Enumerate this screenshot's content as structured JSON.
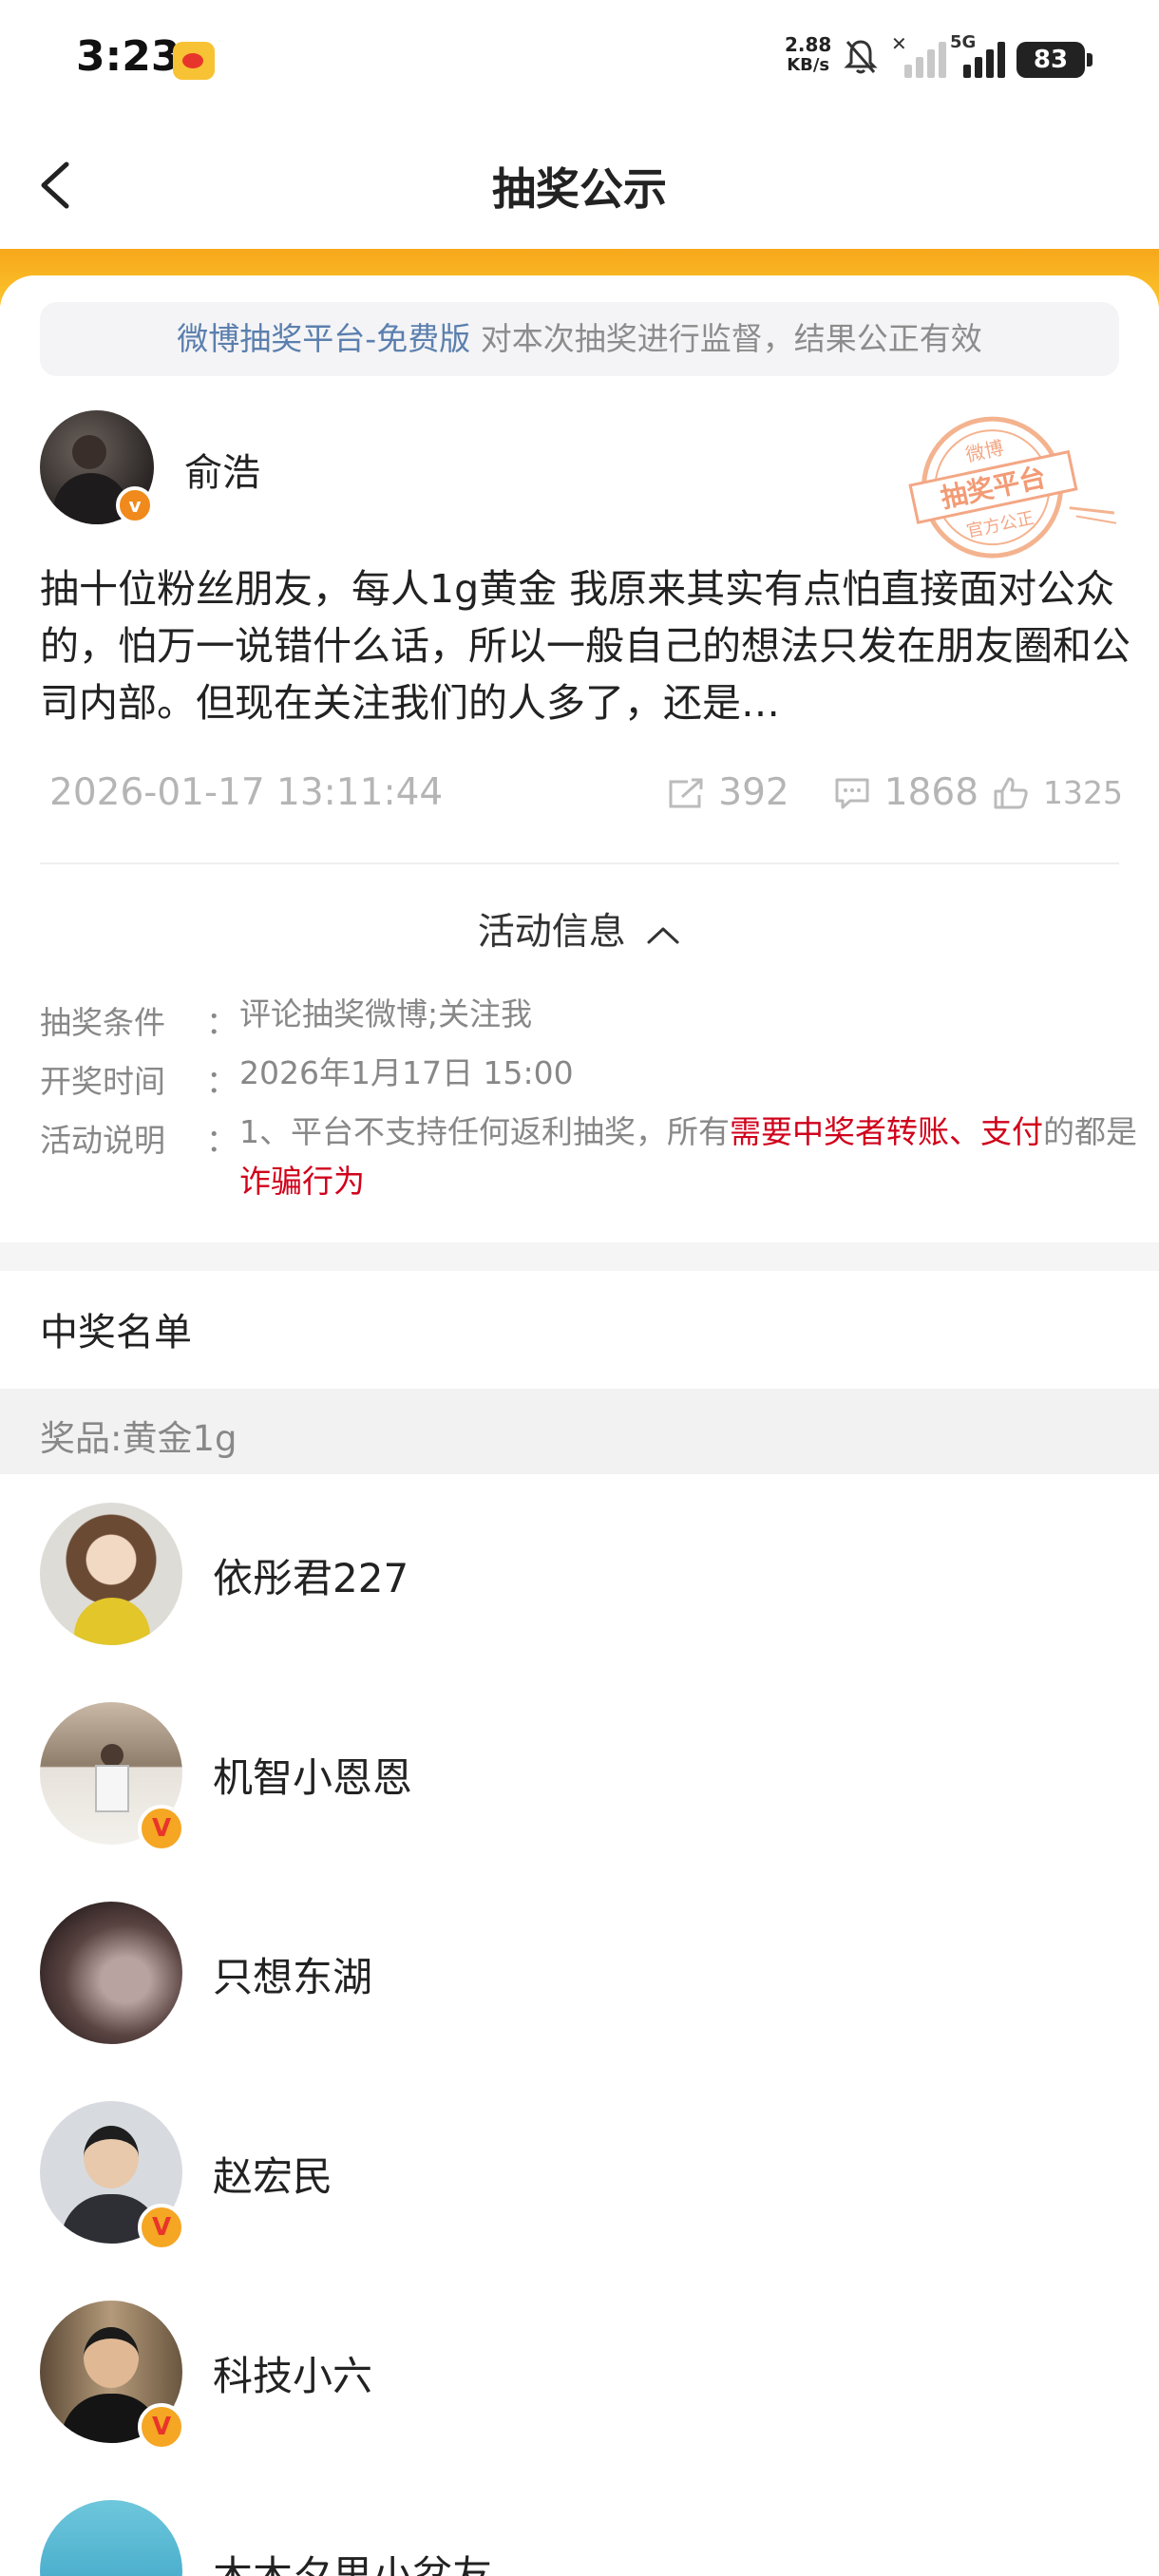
{
  "status_bar": {
    "time": "3:23",
    "net_speed_value": "2.88",
    "net_speed_unit": "KB/s",
    "network": "5G",
    "battery": "83"
  },
  "header": {
    "title": "抽奖公示"
  },
  "notice": {
    "link_text": "微博抽奖平台-免费版",
    "text": " 对本次抽奖进行监督，结果公正有效"
  },
  "post": {
    "author": "俞浩",
    "text": "抽十位粉丝朋友，每人1g黄金 我原来其实有点怕直接面对公众的，怕万一说错什么话，所以一般自己的想法只发在朋友圈和公司内部。但现在关注我们的人多了，还是…",
    "date": "2026-01-17 13:11:44",
    "reposts": "392",
    "comments": "1868",
    "likes": "1325",
    "stamp_top": "微博",
    "stamp_main": "抽奖平台",
    "stamp_bottom": "官方公正"
  },
  "activity": {
    "toggle_label": "活动信息",
    "condition_label": "抽奖条件",
    "condition_value": "评论抽奖微博;关注我",
    "time_label": "开奖时间",
    "time_value": "2026年1月17日 15:00",
    "desc_label": "活动说明",
    "desc_part1": "1、平台不支持任何返利抽奖，所有",
    "desc_red1": "需要中奖者转账、支付",
    "desc_part2": "的都是",
    "desc_red2": "诈骗行为",
    "colon": "："
  },
  "winners": {
    "title": "中奖名单",
    "prize": "奖品:黄金1g",
    "list": [
      {
        "name": "依彤君227"
      },
      {
        "name": "机智小恩恩"
      },
      {
        "name": "只想东湖"
      },
      {
        "name": "赵宏民"
      },
      {
        "name": "科技小六"
      },
      {
        "name": "木木夕里小盆友"
      }
    ]
  },
  "colors": {
    "accent_orange": "#f7a71b",
    "link_blue": "#5b7fae",
    "warning_red": "#d0021b"
  }
}
